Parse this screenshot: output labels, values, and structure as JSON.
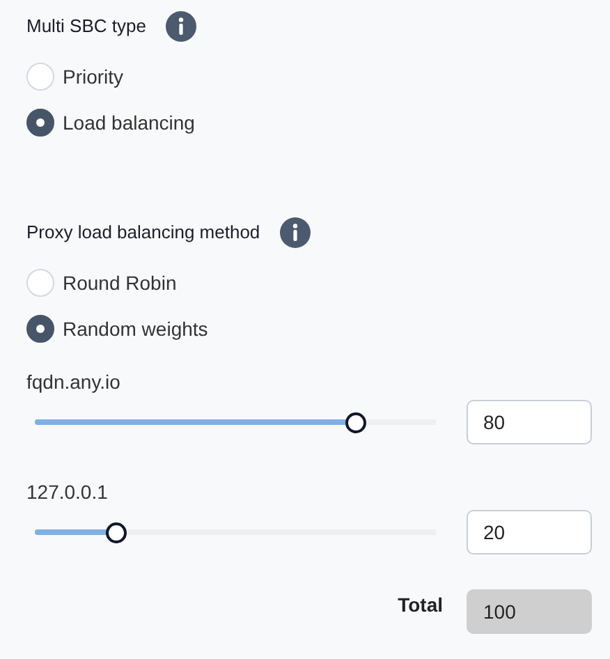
{
  "sections": [
    {
      "title": "Multi SBC type",
      "options": [
        {
          "label": "Priority",
          "selected": false
        },
        {
          "label": "Load balancing",
          "selected": true
        }
      ]
    },
    {
      "title": "Proxy load balancing method",
      "options": [
        {
          "label": "Round Robin",
          "selected": false
        },
        {
          "label": "Random weights",
          "selected": true
        }
      ]
    }
  ],
  "weights": [
    {
      "host": "fqdn.any.io",
      "level": 0.8,
      "value": "80"
    },
    {
      "host": "127.0.0.1",
      "level": 0.2,
      "value": "20"
    }
  ],
  "total": {
    "label": "Total",
    "value": "100"
  }
}
